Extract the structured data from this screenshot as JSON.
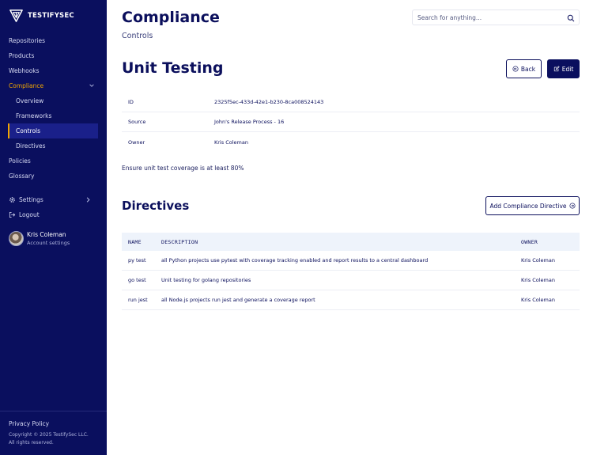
{
  "brand": {
    "name": "TESTIFYSEC"
  },
  "sidebar": {
    "items": [
      {
        "label": "Repositories"
      },
      {
        "label": "Products"
      },
      {
        "label": "Webhooks"
      },
      {
        "label": "Compliance"
      },
      {
        "label": "Overview"
      },
      {
        "label": "Frameworks"
      },
      {
        "label": "Controls"
      },
      {
        "label": "Directives"
      },
      {
        "label": "Policies"
      },
      {
        "label": "Glossary"
      }
    ],
    "settings_label": "Settings",
    "logout_label": "Logout",
    "user": {
      "name": "Kris Coleman",
      "subtitle": "Account settings"
    },
    "footer": {
      "privacy": "Privacy Policy",
      "copyright_line1": "Copyright © 2025 TestifySec LLC.",
      "copyright_line2": "All rights reserved."
    }
  },
  "header": {
    "title": "Compliance",
    "breadcrumb": "Controls",
    "search_placeholder": "Search for anything..."
  },
  "control": {
    "title": "Unit Testing",
    "back_label": "Back",
    "edit_label": "Edit",
    "fields": [
      {
        "label": "ID",
        "value": "2325f5ec-433d-42e1-b230-8ca008524143"
      },
      {
        "label": "Source",
        "value": "John's Release Process - 16"
      },
      {
        "label": "Owner",
        "value": "Kris Coleman"
      }
    ],
    "description": "Ensure unit test coverage is at least 80%"
  },
  "directives": {
    "title": "Directives",
    "add_label": "Add Compliance Directive",
    "columns": [
      "NAME",
      "DESCRIPTION",
      "OWNER"
    ],
    "rows": [
      {
        "name": "py test",
        "description": "all Python projects use pytest with coverage tracking enabled and report results to a central dashboard",
        "owner": "Kris Coleman"
      },
      {
        "name": "go test",
        "description": "Unit testing for golang repositories",
        "owner": "Kris Coleman"
      },
      {
        "name": "run jest",
        "description": "all Node.js projects run jest and generate a coverage report",
        "owner": "Kris Coleman"
      }
    ]
  },
  "colors": {
    "sidebar_bg": "#0a0f5e",
    "accent": "#f0a500",
    "primary_text": "#0b0f5c",
    "table_header_bg": "#eef3fb"
  }
}
